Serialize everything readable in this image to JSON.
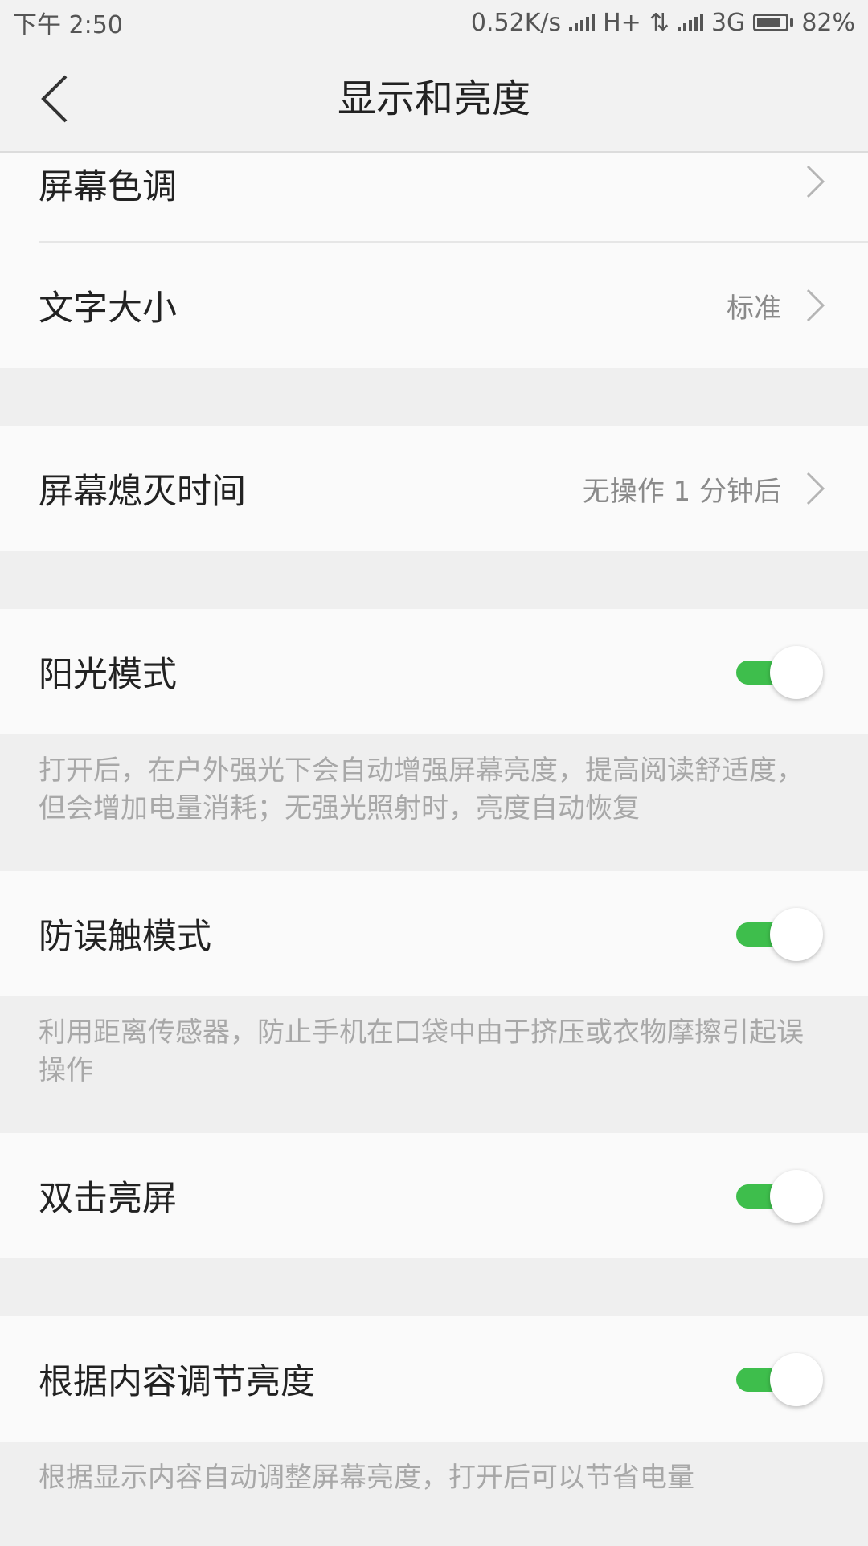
{
  "status_bar": {
    "time": "下午 2:50",
    "net_speed": "0.52K/s",
    "net_type_1": "H+",
    "net_type_2": "3G",
    "battery": "82%",
    "battery_level": 0.82
  },
  "header": {
    "title": "显示和亮度",
    "back_icon": "chevron-left-icon"
  },
  "settings": {
    "screen_tone": {
      "label": "屏幕色调"
    },
    "font_size": {
      "label": "文字大小",
      "value": "标准"
    },
    "screen_timeout": {
      "label": "屏幕熄灭时间",
      "value": "无操作 1 分钟后"
    },
    "sunlight_mode": {
      "label": "阳光模式",
      "on": true,
      "description": "打开后，在户外强光下会自动增强屏幕亮度，提高阅读舒适度，但会增加电量消耗；无强光照射时，亮度自动恢复"
    },
    "anti_mistouch": {
      "label": "防误触模式",
      "on": true,
      "description": "利用距离传感器，防止手机在口袋中由于挤压或衣物摩擦引起误操作"
    },
    "double_tap_wake": {
      "label": "双击亮屏",
      "on": true
    },
    "content_brightness": {
      "label": "根据内容调节亮度",
      "on": true,
      "description": "根据显示内容自动调整屏幕亮度，打开后可以节省电量"
    }
  },
  "colors": {
    "toggle_on": "#3ebe4c",
    "row_bg": "#fafafa",
    "page_bg": "#efefef"
  }
}
